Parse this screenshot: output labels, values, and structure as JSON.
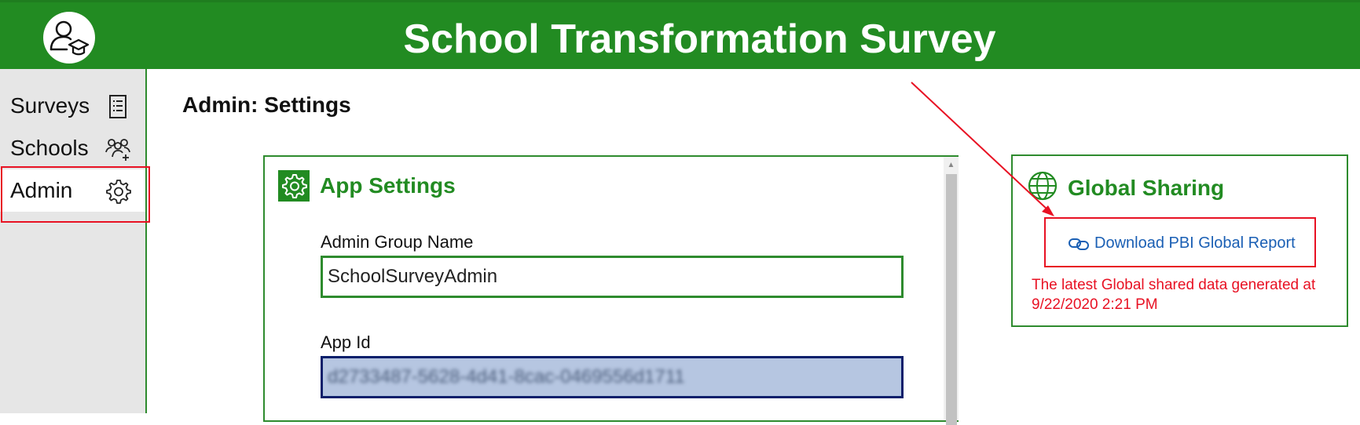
{
  "header": {
    "title": "School Transformation Survey",
    "logo_icon": "student-graduate-icon",
    "background_color": "#228b22"
  },
  "sidebar": {
    "items": [
      {
        "label": "Surveys",
        "icon": "list-icon"
      },
      {
        "label": "Schools",
        "icon": "people-add-icon"
      },
      {
        "label": "Admin",
        "icon": "gear-icon",
        "selected": true
      }
    ]
  },
  "page": {
    "title": "Admin: Settings"
  },
  "app_settings": {
    "title": "App Settings",
    "icon": "gear-icon",
    "fields": [
      {
        "label": "Admin Group Name",
        "value": "SchoolSurveyAdmin"
      },
      {
        "label": "App Id",
        "value": "d2733487-5628-4d41-8cac-0469556d1711",
        "redacted": true
      }
    ]
  },
  "global_sharing": {
    "title": "Global Sharing",
    "icon": "globe-icon",
    "download_link": "Download PBI Global Report",
    "note": "The latest Global shared data generated at 9/22/2020 2:21 PM"
  },
  "colors": {
    "accent": "#228b22",
    "highlight": "#e81123",
    "link": "#1a5fb4"
  }
}
